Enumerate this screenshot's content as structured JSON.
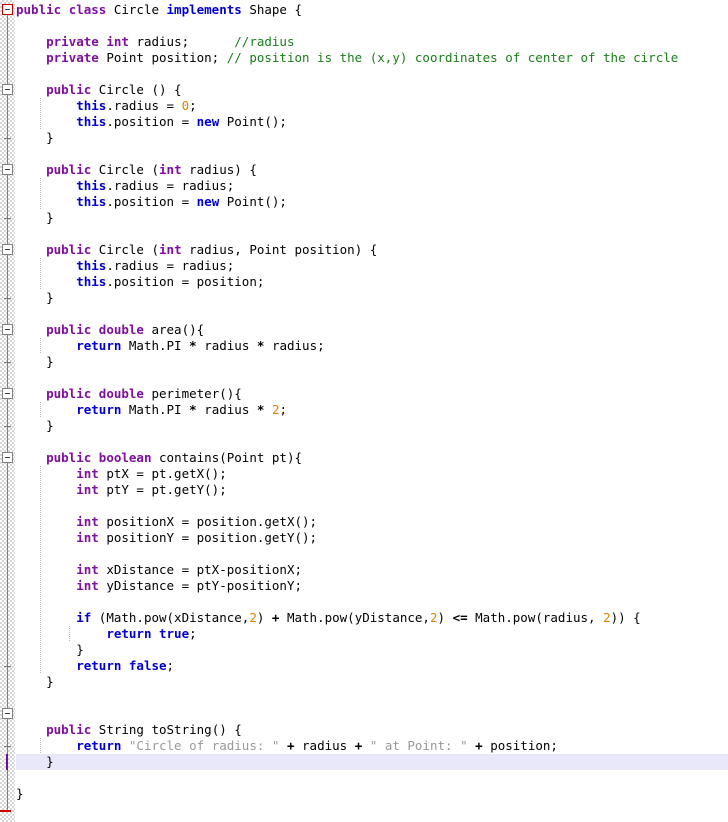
{
  "editor": {
    "language": "java",
    "file_kind": "source-code",
    "font_size_px": 12.5,
    "line_height_px": 16,
    "colors": {
      "background": "#ffffff",
      "keyword_purple": "#7f0f9f",
      "keyword_blue": "#0000d0",
      "comment_green": "#1a7d1a",
      "number_orange": "#e08000",
      "string_gray": "#999999",
      "plain_text": "#000000",
      "current_line_highlight": "#e8e8fa",
      "caret": "#6a0dad",
      "fold_marker_root": "#c00000",
      "fold_marker": "#808080"
    },
    "caret": {
      "line_index": 47,
      "column": 0
    }
  },
  "gutter": {
    "name": "code-folding-gutter",
    "markers": [
      {
        "type": "fold-open-root",
        "line": 0
      },
      {
        "type": "fold-open",
        "line": 5
      },
      {
        "type": "fold-end",
        "line": 8
      },
      {
        "type": "fold-open",
        "line": 10
      },
      {
        "type": "fold-end",
        "line": 13
      },
      {
        "type": "fold-open",
        "line": 15
      },
      {
        "type": "fold-end",
        "line": 18
      },
      {
        "type": "fold-open",
        "line": 20
      },
      {
        "type": "fold-end",
        "line": 22
      },
      {
        "type": "fold-open",
        "line": 24
      },
      {
        "type": "fold-end",
        "line": 26
      },
      {
        "type": "fold-open",
        "line": 28
      },
      {
        "type": "fold-end",
        "line": 41
      },
      {
        "type": "fold-open",
        "line": 44
      },
      {
        "type": "fold-end",
        "line": 46
      },
      {
        "type": "fold-end-root",
        "line": 50
      }
    ]
  },
  "code": {
    "lines": [
      {
        "n": 0,
        "indent": 0,
        "tokens": [
          {
            "t": "public ",
            "c": "kw-mod"
          },
          {
            "t": "class ",
            "c": "kw-mod"
          },
          {
            "t": "Circle ",
            "c": "plain"
          },
          {
            "t": "implements ",
            "c": "kw-blue"
          },
          {
            "t": "Shape {",
            "c": "plain"
          }
        ]
      },
      {
        "n": 1,
        "indent": 0,
        "tokens": []
      },
      {
        "n": 2,
        "indent": 0,
        "tokens": [
          {
            "t": "    ",
            "c": "plain"
          },
          {
            "t": "private ",
            "c": "kw-mod"
          },
          {
            "t": "int ",
            "c": "kw-mod"
          },
          {
            "t": "radius;      ",
            "c": "plain"
          },
          {
            "t": "//radius",
            "c": "cmt"
          }
        ]
      },
      {
        "n": 3,
        "indent": 0,
        "tokens": [
          {
            "t": "    ",
            "c": "plain"
          },
          {
            "t": "private ",
            "c": "kw-mod"
          },
          {
            "t": "Point position; ",
            "c": "plain"
          },
          {
            "t": "// position is the (x,y) coordinates of center of the circle",
            "c": "cmt"
          }
        ]
      },
      {
        "n": 4,
        "indent": 0,
        "tokens": []
      },
      {
        "n": 5,
        "indent": 0,
        "tokens": [
          {
            "t": "    ",
            "c": "plain"
          },
          {
            "t": "public ",
            "c": "kw-mod"
          },
          {
            "t": "Circle () {",
            "c": "plain"
          }
        ]
      },
      {
        "n": 6,
        "indent": 1,
        "tokens": [
          {
            "t": "        ",
            "c": "plain"
          },
          {
            "t": "this",
            "c": "kw-blue"
          },
          {
            "t": ".radius = ",
            "c": "plain"
          },
          {
            "t": "0",
            "c": "num"
          },
          {
            "t": ";",
            "c": "plain"
          }
        ]
      },
      {
        "n": 7,
        "indent": 1,
        "tokens": [
          {
            "t": "        ",
            "c": "plain"
          },
          {
            "t": "this",
            "c": "kw-blue"
          },
          {
            "t": ".position = ",
            "c": "plain"
          },
          {
            "t": "new ",
            "c": "kw-blue"
          },
          {
            "t": "Point();",
            "c": "plain"
          }
        ]
      },
      {
        "n": 8,
        "indent": 0,
        "tokens": [
          {
            "t": "    }",
            "c": "plain"
          }
        ]
      },
      {
        "n": 9,
        "indent": 0,
        "tokens": []
      },
      {
        "n": 10,
        "indent": 0,
        "tokens": [
          {
            "t": "    ",
            "c": "plain"
          },
          {
            "t": "public ",
            "c": "kw-mod"
          },
          {
            "t": "Circle (",
            "c": "plain"
          },
          {
            "t": "int ",
            "c": "kw-mod"
          },
          {
            "t": "radius) {",
            "c": "plain"
          }
        ]
      },
      {
        "n": 11,
        "indent": 1,
        "tokens": [
          {
            "t": "        ",
            "c": "plain"
          },
          {
            "t": "this",
            "c": "kw-blue"
          },
          {
            "t": ".radius = radius;",
            "c": "plain"
          }
        ]
      },
      {
        "n": 12,
        "indent": 1,
        "tokens": [
          {
            "t": "        ",
            "c": "plain"
          },
          {
            "t": "this",
            "c": "kw-blue"
          },
          {
            "t": ".position = ",
            "c": "plain"
          },
          {
            "t": "new ",
            "c": "kw-blue"
          },
          {
            "t": "Point();",
            "c": "plain"
          }
        ]
      },
      {
        "n": 13,
        "indent": 0,
        "tokens": [
          {
            "t": "    }",
            "c": "plain"
          }
        ]
      },
      {
        "n": 14,
        "indent": 0,
        "tokens": []
      },
      {
        "n": 15,
        "indent": 0,
        "tokens": [
          {
            "t": "    ",
            "c": "plain"
          },
          {
            "t": "public ",
            "c": "kw-mod"
          },
          {
            "t": "Circle (",
            "c": "plain"
          },
          {
            "t": "int ",
            "c": "kw-mod"
          },
          {
            "t": "radius, Point position) {",
            "c": "plain"
          }
        ]
      },
      {
        "n": 16,
        "indent": 1,
        "tokens": [
          {
            "t": "        ",
            "c": "plain"
          },
          {
            "t": "this",
            "c": "kw-blue"
          },
          {
            "t": ".radius = radius;",
            "c": "plain"
          }
        ]
      },
      {
        "n": 17,
        "indent": 1,
        "tokens": [
          {
            "t": "        ",
            "c": "plain"
          },
          {
            "t": "this",
            "c": "kw-blue"
          },
          {
            "t": ".position = position;",
            "c": "plain"
          }
        ]
      },
      {
        "n": 18,
        "indent": 0,
        "tokens": [
          {
            "t": "    }",
            "c": "plain"
          }
        ]
      },
      {
        "n": 19,
        "indent": 0,
        "tokens": []
      },
      {
        "n": 20,
        "indent": 0,
        "tokens": [
          {
            "t": "    ",
            "c": "plain"
          },
          {
            "t": "public ",
            "c": "kw-mod"
          },
          {
            "t": "double ",
            "c": "kw-mod"
          },
          {
            "t": "area(){",
            "c": "plain"
          }
        ]
      },
      {
        "n": 21,
        "indent": 1,
        "tokens": [
          {
            "t": "        ",
            "c": "plain"
          },
          {
            "t": "return ",
            "c": "kw-blue"
          },
          {
            "t": "Math.PI ",
            "c": "plain"
          },
          {
            "t": "* ",
            "c": "op"
          },
          {
            "t": "radius ",
            "c": "plain"
          },
          {
            "t": "* ",
            "c": "op"
          },
          {
            "t": "radius;",
            "c": "plain"
          }
        ]
      },
      {
        "n": 22,
        "indent": 0,
        "tokens": [
          {
            "t": "    }",
            "c": "plain"
          }
        ]
      },
      {
        "n": 23,
        "indent": 0,
        "tokens": []
      },
      {
        "n": 24,
        "indent": 0,
        "tokens": [
          {
            "t": "    ",
            "c": "plain"
          },
          {
            "t": "public ",
            "c": "kw-mod"
          },
          {
            "t": "double ",
            "c": "kw-mod"
          },
          {
            "t": "perimeter(){",
            "c": "plain"
          }
        ]
      },
      {
        "n": 25,
        "indent": 1,
        "tokens": [
          {
            "t": "        ",
            "c": "plain"
          },
          {
            "t": "return ",
            "c": "kw-blue"
          },
          {
            "t": "Math.PI ",
            "c": "plain"
          },
          {
            "t": "* ",
            "c": "op"
          },
          {
            "t": "radius ",
            "c": "plain"
          },
          {
            "t": "* ",
            "c": "op"
          },
          {
            "t": "2",
            "c": "num"
          },
          {
            "t": ";",
            "c": "plain"
          }
        ]
      },
      {
        "n": 26,
        "indent": 0,
        "tokens": [
          {
            "t": "    }",
            "c": "plain"
          }
        ]
      },
      {
        "n": 27,
        "indent": 0,
        "tokens": []
      },
      {
        "n": 28,
        "indent": 0,
        "tokens": [
          {
            "t": "    ",
            "c": "plain"
          },
          {
            "t": "public ",
            "c": "kw-mod"
          },
          {
            "t": "boolean ",
            "c": "kw-mod"
          },
          {
            "t": "contains(Point pt){",
            "c": "plain"
          }
        ]
      },
      {
        "n": 29,
        "indent": 1,
        "tokens": [
          {
            "t": "        ",
            "c": "plain"
          },
          {
            "t": "int ",
            "c": "kw-mod"
          },
          {
            "t": "ptX = pt.getX();",
            "c": "plain"
          }
        ]
      },
      {
        "n": 30,
        "indent": 1,
        "tokens": [
          {
            "t": "        ",
            "c": "plain"
          },
          {
            "t": "int ",
            "c": "kw-mod"
          },
          {
            "t": "ptY = pt.getY();",
            "c": "plain"
          }
        ]
      },
      {
        "n": 31,
        "indent": 1,
        "tokens": []
      },
      {
        "n": 32,
        "indent": 1,
        "tokens": [
          {
            "t": "        ",
            "c": "plain"
          },
          {
            "t": "int ",
            "c": "kw-mod"
          },
          {
            "t": "positionX = position.getX();",
            "c": "plain"
          }
        ]
      },
      {
        "n": 33,
        "indent": 1,
        "tokens": [
          {
            "t": "        ",
            "c": "plain"
          },
          {
            "t": "int ",
            "c": "kw-mod"
          },
          {
            "t": "positionY = position.getY();",
            "c": "plain"
          }
        ]
      },
      {
        "n": 34,
        "indent": 1,
        "tokens": []
      },
      {
        "n": 35,
        "indent": 1,
        "tokens": [
          {
            "t": "        ",
            "c": "plain"
          },
          {
            "t": "int ",
            "c": "kw-mod"
          },
          {
            "t": "xDistance = ptX-positionX;",
            "c": "plain"
          }
        ]
      },
      {
        "n": 36,
        "indent": 1,
        "tokens": [
          {
            "t": "        ",
            "c": "plain"
          },
          {
            "t": "int ",
            "c": "kw-mod"
          },
          {
            "t": "yDistance = ptY-positionY;",
            "c": "plain"
          }
        ]
      },
      {
        "n": 37,
        "indent": 1,
        "tokens": []
      },
      {
        "n": 38,
        "indent": 1,
        "tokens": [
          {
            "t": "        ",
            "c": "plain"
          },
          {
            "t": "if ",
            "c": "kw-blue"
          },
          {
            "t": "(Math.pow(xDistance,",
            "c": "plain"
          },
          {
            "t": "2",
            "c": "num"
          },
          {
            "t": ") ",
            "c": "plain"
          },
          {
            "t": "+ ",
            "c": "op"
          },
          {
            "t": "Math.pow(yDistance,",
            "c": "plain"
          },
          {
            "t": "2",
            "c": "num"
          },
          {
            "t": ") ",
            "c": "plain"
          },
          {
            "t": "<= ",
            "c": "op"
          },
          {
            "t": "Math.pow(radius, ",
            "c": "plain"
          },
          {
            "t": "2",
            "c": "num"
          },
          {
            "t": ")) {",
            "c": "plain"
          }
        ]
      },
      {
        "n": 39,
        "indent": 2,
        "tokens": [
          {
            "t": "            ",
            "c": "plain"
          },
          {
            "t": "return ",
            "c": "kw-blue"
          },
          {
            "t": "true",
            "c": "kw-blue"
          },
          {
            "t": ";",
            "c": "plain"
          }
        ]
      },
      {
        "n": 40,
        "indent": 1,
        "tokens": [
          {
            "t": "        }",
            "c": "plain"
          }
        ]
      },
      {
        "n": 41,
        "indent": 1,
        "tokens": [
          {
            "t": "        ",
            "c": "plain"
          },
          {
            "t": "return ",
            "c": "kw-blue"
          },
          {
            "t": "false",
            "c": "kw-blue"
          },
          {
            "t": ";",
            "c": "plain"
          }
        ]
      },
      {
        "n": 42,
        "indent": 0,
        "tokens": [
          {
            "t": "    }",
            "c": "plain"
          }
        ]
      },
      {
        "n": 43,
        "indent": 0,
        "tokens": []
      },
      {
        "n": 44,
        "indent": 0,
        "tokens": []
      },
      {
        "n": 45,
        "indent": 0,
        "tokens": [
          {
            "t": "    ",
            "c": "plain"
          },
          {
            "t": "public ",
            "c": "kw-mod"
          },
          {
            "t": "String ",
            "c": "plain"
          },
          {
            "t": "toString() {",
            "c": "plain"
          }
        ]
      },
      {
        "n": 46,
        "indent": 1,
        "tokens": [
          {
            "t": "        ",
            "c": "plain"
          },
          {
            "t": "return ",
            "c": "kw-blue"
          },
          {
            "t": "\"Circle of radius: \" ",
            "c": "str"
          },
          {
            "t": "+ ",
            "c": "op"
          },
          {
            "t": "radius ",
            "c": "plain"
          },
          {
            "t": "+ ",
            "c": "op"
          },
          {
            "t": "\" at Point: \" ",
            "c": "str"
          },
          {
            "t": "+ ",
            "c": "op"
          },
          {
            "t": "position;",
            "c": "plain"
          }
        ]
      },
      {
        "n": 47,
        "indent": 0,
        "tokens": [
          {
            "t": "    }",
            "c": "plain"
          }
        ]
      },
      {
        "n": 48,
        "indent": 0,
        "tokens": []
      },
      {
        "n": 49,
        "indent": 0,
        "tokens": [
          {
            "t": "}",
            "c": "plain"
          }
        ]
      }
    ],
    "indent_guides": [
      {
        "col": 4,
        "from_line": 6,
        "to_line": 8
      },
      {
        "col": 4,
        "from_line": 11,
        "to_line": 13
      },
      {
        "col": 4,
        "from_line": 16,
        "to_line": 18
      },
      {
        "col": 4,
        "from_line": 21,
        "to_line": 22
      },
      {
        "col": 4,
        "from_line": 25,
        "to_line": 26
      },
      {
        "col": 4,
        "from_line": 29,
        "to_line": 42
      },
      {
        "col": 8,
        "from_line": 39,
        "to_line": 40
      },
      {
        "col": 4,
        "from_line": 46,
        "to_line": 47
      }
    ]
  }
}
